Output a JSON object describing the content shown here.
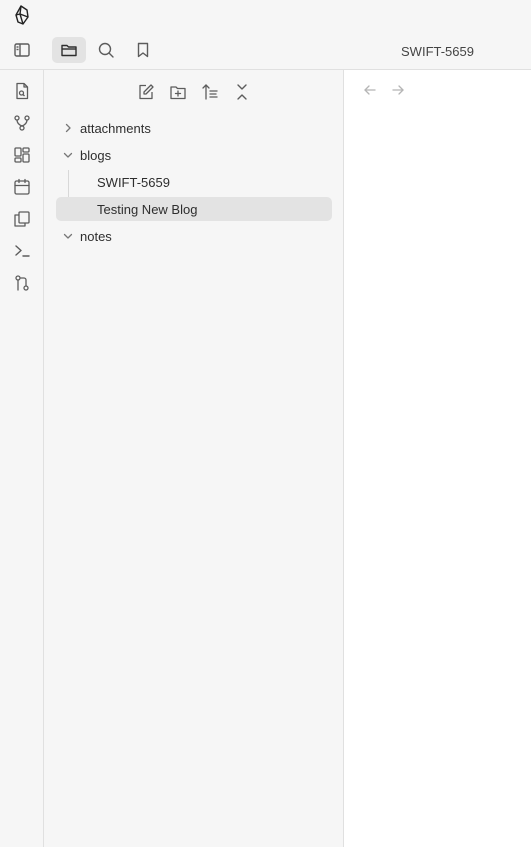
{
  "titlebar": {
    "app_icon": "obsidian-logo-icon",
    "tabs": [
      {
        "icon": "sidebar-toggle-icon"
      },
      {
        "icon": "folder-icon",
        "active": true
      },
      {
        "icon": "search-icon"
      },
      {
        "icon": "bookmark-icon"
      }
    ],
    "active_tab_title": "SWIFT-5659"
  },
  "ribbon": {
    "items": [
      {
        "icon": "quick-switcher-icon"
      },
      {
        "icon": "graph-view-icon"
      },
      {
        "icon": "canvas-icon"
      },
      {
        "icon": "daily-note-icon"
      },
      {
        "icon": "templates-icon"
      },
      {
        "icon": "command-palette-icon"
      },
      {
        "icon": "git-icon"
      }
    ]
  },
  "file_explorer": {
    "actions": [
      {
        "icon": "new-note-icon"
      },
      {
        "icon": "new-folder-icon"
      },
      {
        "icon": "sort-icon"
      },
      {
        "icon": "collapse-all-icon"
      }
    ],
    "tree": {
      "attachments": "attachments",
      "blogs": "blogs",
      "blog_file_1": "SWIFT-5659",
      "blog_file_2": "Testing New Blog",
      "notes": "notes"
    }
  },
  "editor": {
    "back_icon": "arrow-left-icon",
    "forward_icon": "arrow-right-icon"
  },
  "colors": {
    "sidebar_bg": "#f6f6f6",
    "selected_bg": "#e3e3e3",
    "border": "#e0e0e0",
    "text": "#2e2e2e",
    "icon": "#5c5c5c"
  }
}
